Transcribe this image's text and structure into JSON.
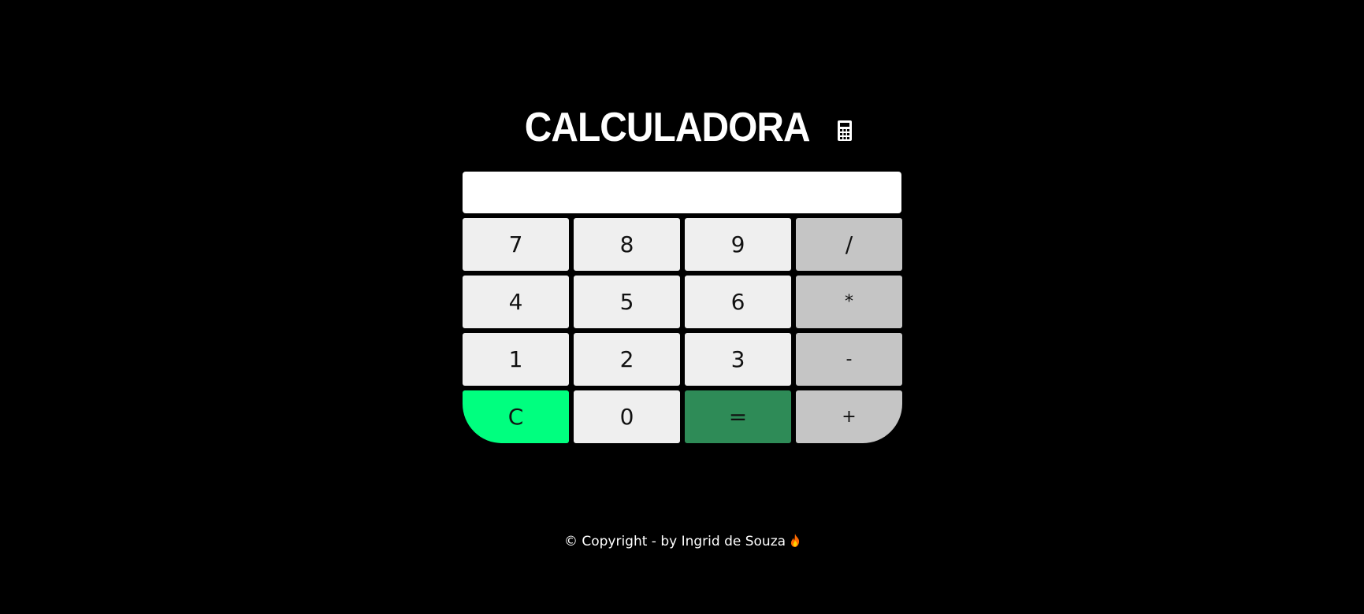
{
  "header": {
    "title": "CALCULADORA",
    "icon": "calculator-icon"
  },
  "display": {
    "value": ""
  },
  "keypad": {
    "rows": [
      [
        "7",
        "8",
        "9",
        "/"
      ],
      [
        "4",
        "5",
        "6",
        "*"
      ],
      [
        "1",
        "2",
        "3",
        "-"
      ],
      [
        "C",
        "0",
        "=",
        "+"
      ]
    ]
  },
  "colors": {
    "background": "#000000",
    "digit_key": "#efefef",
    "operator_key": "#c5c5c5",
    "clear_key": "#00ff7f",
    "equals_key": "#2e8b57"
  },
  "footer": {
    "text": "© Copyright - by Ingrid de Souza",
    "icon": "fire-icon"
  }
}
